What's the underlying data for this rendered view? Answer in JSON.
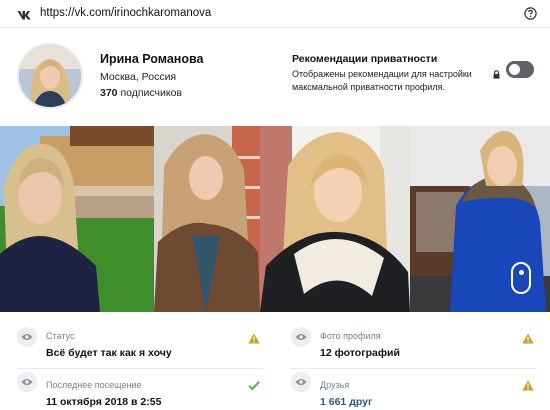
{
  "browser": {
    "url": "https://vk.com/irinochkaromanova",
    "logo_icon": "vk-logo-icon",
    "help_icon": "help-icon"
  },
  "profile": {
    "name": "Ирина Романова",
    "city": "Москва, Россия",
    "followers_count": "370",
    "followers_label": "подписчиков"
  },
  "privacy": {
    "title": "Рекомендации приватности",
    "description": "Отображены рекомендации для настройки максмальной приватности профиля.",
    "toggle_on": false,
    "lock_icon": "lock-icon"
  },
  "photos": [
    {
      "name": "photo-1"
    },
    {
      "name": "photo-2"
    },
    {
      "name": "photo-3"
    },
    {
      "name": "photo-4"
    }
  ],
  "info": {
    "status": {
      "label": "Статус",
      "value": "Всё будет так как я хочу",
      "state": "warning"
    },
    "photos": {
      "label": "Фото профиля",
      "value": "12 фотографий",
      "state": "warning"
    },
    "last_seen": {
      "label": "Последнее посещение",
      "value": "11 октября 2018 в 2:55",
      "state": "ok"
    },
    "friends": {
      "label": "Друзья",
      "value": "1 661 друг",
      "state": "warning"
    }
  },
  "colors": {
    "warning": "#c8a11d",
    "ok": "#4bb34b",
    "link": "#2a5885",
    "toggle_off": "#5f6368"
  }
}
